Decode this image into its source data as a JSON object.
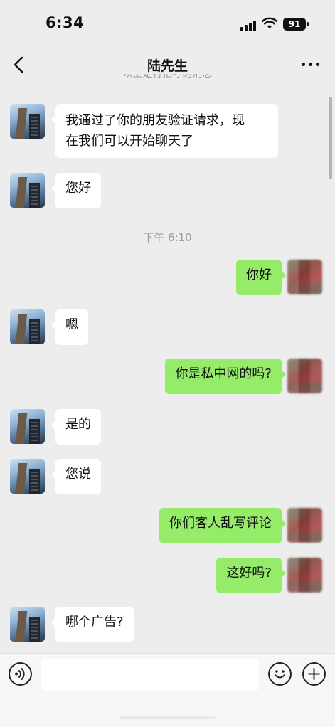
{
  "status_bar": {
    "time": "6:34",
    "battery": "91"
  },
  "header": {
    "title": "陆先生",
    "cut_off_text": "以上是打招呼的消息"
  },
  "messages": [
    {
      "side": "left",
      "text_lines": [
        "我通过了你的朋友验证请求，现",
        "在我们可以开始聊天了"
      ]
    },
    {
      "side": "left",
      "text": "您好"
    },
    {
      "type": "timestamp",
      "text": "下午 6:10"
    },
    {
      "side": "right",
      "text": "你好"
    },
    {
      "side": "left",
      "text": "嗯"
    },
    {
      "side": "right",
      "text": "你是私中网的吗?"
    },
    {
      "side": "left",
      "text": "是的"
    },
    {
      "side": "left",
      "text": "您说"
    },
    {
      "side": "right",
      "text": "你们客人乱写评论"
    },
    {
      "side": "right",
      "text": "这好吗?"
    },
    {
      "side": "left",
      "text": "哪个广告?"
    }
  ],
  "input_bar": {
    "message_value": ""
  }
}
